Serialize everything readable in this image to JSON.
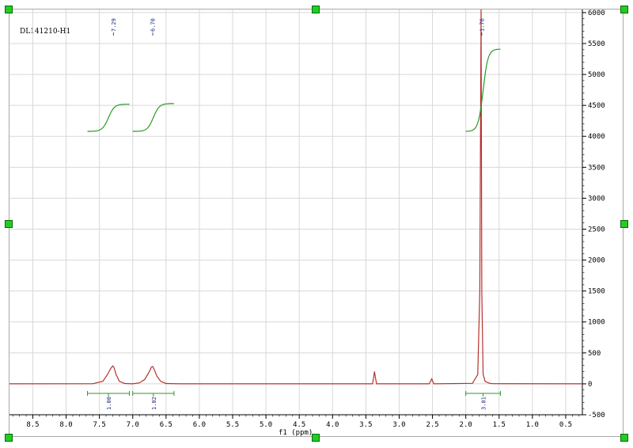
{
  "sample_name": "DL141210-H1",
  "chart_data": {
    "type": "line",
    "xlabel": "f1 (ppm)",
    "ylabel": "",
    "xlim": [
      8.85,
      0.25
    ],
    "ylim": [
      -500,
      6050
    ],
    "x_ticks": [
      "8.5",
      "8.0",
      "7.5",
      "7.0",
      "6.5",
      "6.0",
      "5.5",
      "5.0",
      "4.5",
      "4.0",
      "3.5",
      "3.0",
      "2.5",
      "2.0",
      "1.5",
      "1.0",
      "0.5"
    ],
    "y_ticks": [
      "6000",
      "5500",
      "5000",
      "4500",
      "4000",
      "3500",
      "3000",
      "2500",
      "2000",
      "1500",
      "1000",
      "500",
      "0",
      "-500"
    ],
    "grid": true,
    "series": [
      {
        "x": [
          8.85,
          7.6,
          7.45,
          7.38,
          7.33,
          7.3,
          7.28,
          7.25,
          7.2,
          7.12,
          7.0,
          6.9,
          6.82,
          6.75,
          6.72,
          6.7,
          6.68,
          6.64,
          6.58,
          6.5,
          6.3,
          3.4,
          3.38,
          3.37,
          3.36,
          3.34,
          2.55,
          2.52,
          2.51,
          2.5,
          2.48,
          1.9,
          1.82,
          1.79,
          1.77,
          1.76,
          1.74,
          1.71,
          1.65,
          1.6,
          0.25
        ],
        "y": [
          0,
          2,
          40,
          150,
          250,
          290,
          260,
          150,
          40,
          5,
          0,
          15,
          70,
          200,
          270,
          280,
          240,
          130,
          40,
          5,
          0,
          0,
          120,
          200,
          120,
          0,
          0,
          60,
          80,
          50,
          0,
          8,
          150,
          1500,
          6050,
          1500,
          150,
          40,
          10,
          3,
          0
        ]
      }
    ],
    "peak_labels": [
      {
        "x": 7.29,
        "label": "7.29"
      },
      {
        "x": 6.7,
        "label": "6.70"
      },
      {
        "x": 1.76,
        "label": "1.76"
      }
    ],
    "integrals": [
      {
        "from": 7.68,
        "to": 7.05,
        "value": "1.00"
      },
      {
        "from": 7.0,
        "to": 6.38,
        "value": "1.02"
      },
      {
        "from": 2.0,
        "to": 1.48,
        "value": "3.01"
      }
    ],
    "colors": {
      "spectrum": "#b5322f",
      "integral": "#2a9a2a",
      "peak_label": "#1a237e",
      "grid": "#d8d8d8"
    }
  }
}
